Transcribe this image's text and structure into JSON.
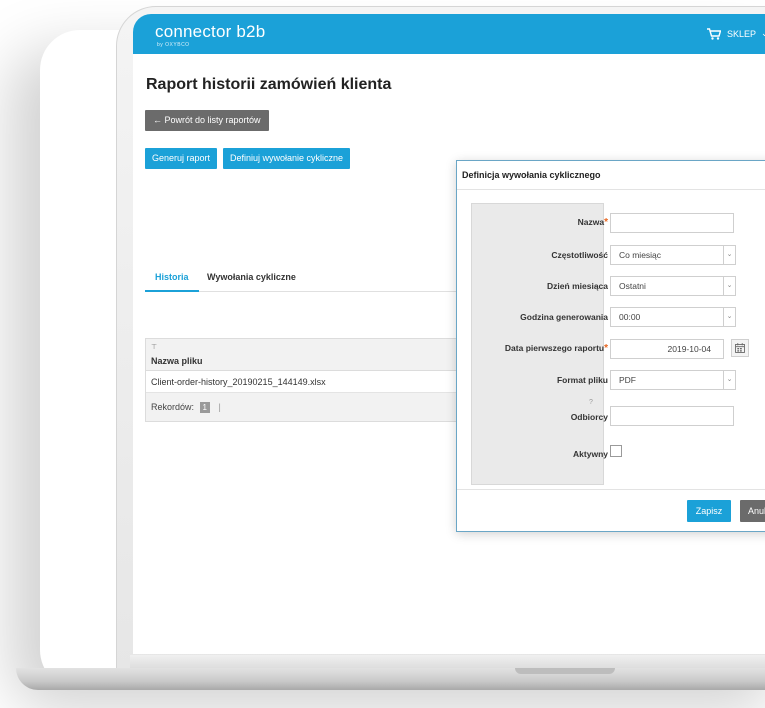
{
  "header": {
    "logo": "connector b2b",
    "logo_sub": "by OXYBCO",
    "shop_label": "SKLEP",
    "shop_chevron": "⌄"
  },
  "page": {
    "title": "Raport historii zamówień klienta",
    "back_button": "← Powrót do listy raportów",
    "generate_button": "Generuj raport",
    "define_button": "Definiuj wywołanie cykliczne"
  },
  "tabs": [
    {
      "label": "Historia",
      "active": true
    },
    {
      "label": "Wywołania cykliczne",
      "active": false
    }
  ],
  "grid": {
    "filter_icon": "⊤",
    "column": "Nazwa pliku",
    "rows": [
      "Client-order-history_20190215_144149.xlsx"
    ],
    "records_label": "Rekordów:",
    "page_number": "1",
    "separator": "|"
  },
  "dialog": {
    "title": "Definicja wywołania cyklicznego",
    "fields": {
      "name": {
        "label": "Nazwa",
        "required": "*",
        "value": ""
      },
      "frequency": {
        "label": "Częstotliwość",
        "value": "Co miesiąc"
      },
      "day_of_month": {
        "label": "Dzień miesiąca",
        "value": "Ostatni"
      },
      "time": {
        "label": "Godzina generowania",
        "value": "00:00"
      },
      "first_date": {
        "label": "Data pierwszego raportu",
        "required": "*",
        "value": "2019-10-04"
      },
      "format": {
        "label": "Format pliku",
        "value": "PDF"
      },
      "recipients": {
        "label": "Odbiorcy",
        "help": "?",
        "value": ""
      },
      "active": {
        "label": "Aktywny",
        "checked": false
      }
    },
    "save_button": "Zapisz",
    "cancel_button": "Anuluj"
  },
  "colors": {
    "accent": "#1ba1d8",
    "dark_button": "#6b6b6b",
    "required": "#e8651f"
  },
  "icons": [
    "cart-icon",
    "chevron-down-icon",
    "filter-icon",
    "calendar-icon",
    "arrow-left-icon"
  ]
}
